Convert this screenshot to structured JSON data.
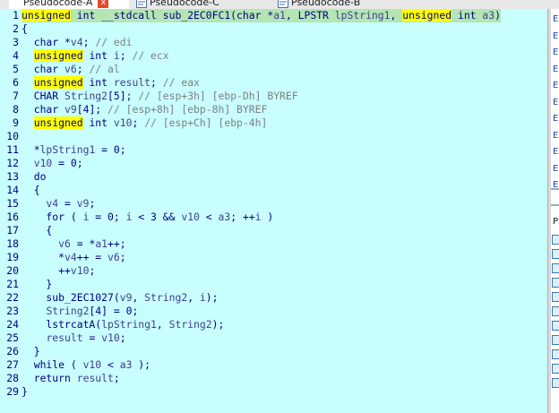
{
  "tabs": [
    {
      "label": "Pseudocode-A",
      "close": "x"
    },
    {
      "label": "Pseudocode-C"
    },
    {
      "label": "Pseudocode-B"
    }
  ],
  "code_lines": [
    {
      "n": "1",
      "text": "unsigned int __stdcall sub_2EC0FC1(char *a1, LPSTR lpString1, unsigned int a3)"
    },
    {
      "n": "2",
      "text": "{"
    },
    {
      "n": "3",
      "text": "  char *v4; // edi"
    },
    {
      "n": "4",
      "text": "  unsigned int i; // ecx"
    },
    {
      "n": "5",
      "text": "  char v6; // al"
    },
    {
      "n": "6",
      "text": "  unsigned int result; // eax"
    },
    {
      "n": "7",
      "text": "  CHAR String2[5]; // [esp+3h] [ebp-Dh] BYREF"
    },
    {
      "n": "8",
      "text": "  char v9[4]; // [esp+8h] [ebp-8h] BYREF"
    },
    {
      "n": "9",
      "text": "  unsigned int v10; // [esp+Ch] [ebp-4h]"
    },
    {
      "n": "10",
      "text": ""
    },
    {
      "n": "11",
      "text": "  *lpString1 = 0;"
    },
    {
      "n": "12",
      "text": "  v10 = 0;"
    },
    {
      "n": "13",
      "text": "  do"
    },
    {
      "n": "14",
      "text": "  {"
    },
    {
      "n": "15",
      "text": "    v4 = v9;"
    },
    {
      "n": "16",
      "text": "    for ( i = 0; i < 3 && v10 < a3; ++i )"
    },
    {
      "n": "17",
      "text": "    {"
    },
    {
      "n": "18",
      "text": "      v6 = *a1++;"
    },
    {
      "n": "19",
      "text": "      *v4++ = v6;"
    },
    {
      "n": "20",
      "text": "      ++v10;"
    },
    {
      "n": "21",
      "text": "    }"
    },
    {
      "n": "22",
      "text": "    sub_2EC1027(v9, String2, i);"
    },
    {
      "n": "23",
      "text": "    String2[4] = 0;"
    },
    {
      "n": "24",
      "text": "    lstrcatA(lpString1, String2);"
    },
    {
      "n": "25",
      "text": "    result = v10;"
    },
    {
      "n": "26",
      "text": "  }"
    },
    {
      "n": "27",
      "text": "  while ( v10 < a3 );"
    },
    {
      "n": "28",
      "text": "  return result;"
    },
    {
      "n": "29",
      "text": "}"
    }
  ],
  "side_panel": {
    "letters": [
      "E",
      "E",
      "E",
      "E",
      "E",
      "E",
      "E",
      "E",
      "E",
      "E",
      "E"
    ],
    "heading": "P"
  },
  "colors": {
    "editor_bg": "#c8fefe",
    "keyword_highlight": "#ffff00",
    "line_highlight": "#b4e6b4",
    "text": "#000080",
    "comment": "#808080"
  }
}
